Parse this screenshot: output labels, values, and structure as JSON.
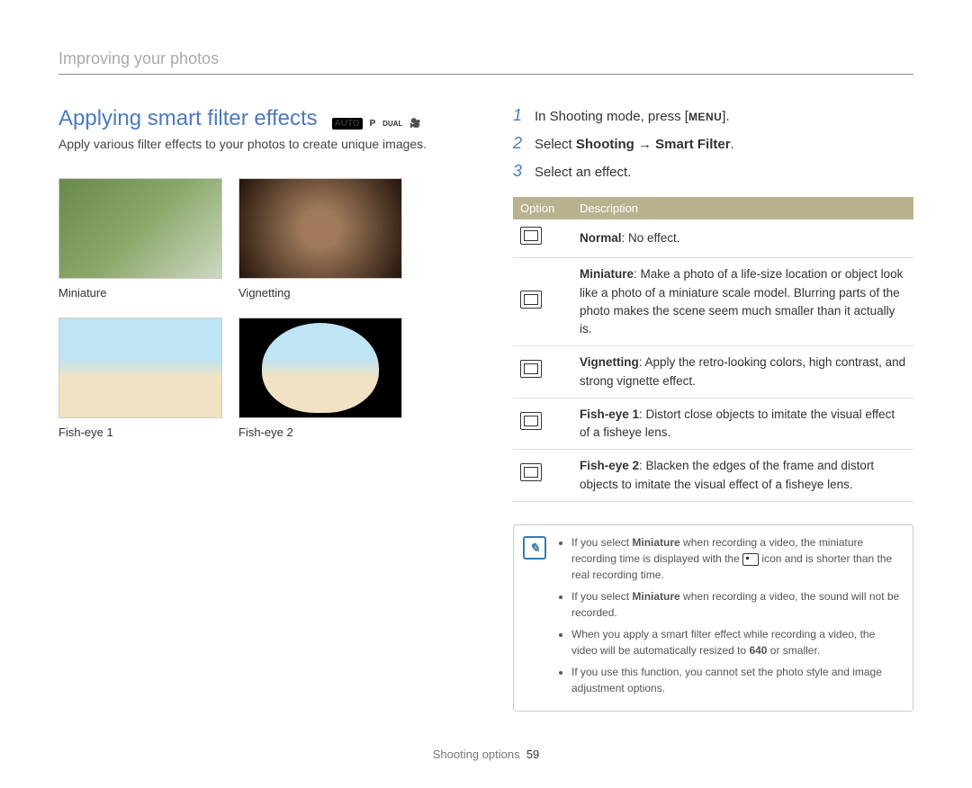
{
  "breadcrumb": "Improving your photos",
  "section_title": "Applying smart filter effects",
  "mode_icons": [
    "AUTO",
    "P",
    "DUAL",
    "🎥"
  ],
  "intro": "Apply various filter effects to your photos to create unique images.",
  "thumbs": [
    {
      "caption": "Miniature"
    },
    {
      "caption": "Vignetting"
    },
    {
      "caption": "Fish-eye 1"
    },
    {
      "caption": "Fish-eye 2"
    }
  ],
  "steps": [
    {
      "num": "1",
      "text_pre": "In Shooting mode, press [",
      "badge": "MENU",
      "text_post": "]."
    },
    {
      "num": "2",
      "text_pre": "Select ",
      "bold": "Shooting → Smart Filter",
      "text_post": "."
    },
    {
      "num": "3",
      "text_pre": "Select an effect.",
      "bold": "",
      "text_post": ""
    }
  ],
  "table": {
    "headers": [
      "Option",
      "Description"
    ],
    "rows": [
      {
        "name": "Normal",
        "desc": ": No effect."
      },
      {
        "name": "Miniature",
        "desc": ": Make a photo of a life-size location or object look like a photo of a miniature scale model. Blurring parts of the photo makes the scene seem much smaller than it actually is."
      },
      {
        "name": "Vignetting",
        "desc": ": Apply the retro-looking colors, high contrast, and strong vignette effect."
      },
      {
        "name": "Fish-eye 1",
        "desc": ": Distort close objects to imitate the visual effect of a fisheye lens."
      },
      {
        "name": "Fish-eye 2",
        "desc": ": Blacken the edges of the frame and distort objects to imitate the visual effect of a fisheye lens."
      }
    ]
  },
  "notes": [
    {
      "pre": "If you select ",
      "bold": "Miniature",
      "mid": " when recording a video, the miniature recording time is displayed with the ",
      "icon": true,
      "post": " icon and is shorter than the real recording time."
    },
    {
      "pre": "If you select ",
      "bold": "Miniature",
      "mid": " when recording a video, the sound will not be recorded.",
      "icon": false,
      "post": ""
    },
    {
      "pre": "When you apply a smart filter effect while recording a video, the video will be automatically resized to ",
      "bold": "640",
      "mid": " or smaller.",
      "icon": false,
      "post": ""
    },
    {
      "pre": "If you use this function, you cannot set the photo style and image adjustment options.",
      "bold": "",
      "mid": "",
      "icon": false,
      "post": ""
    }
  ],
  "footer": {
    "section": "Shooting options",
    "page": "59"
  }
}
